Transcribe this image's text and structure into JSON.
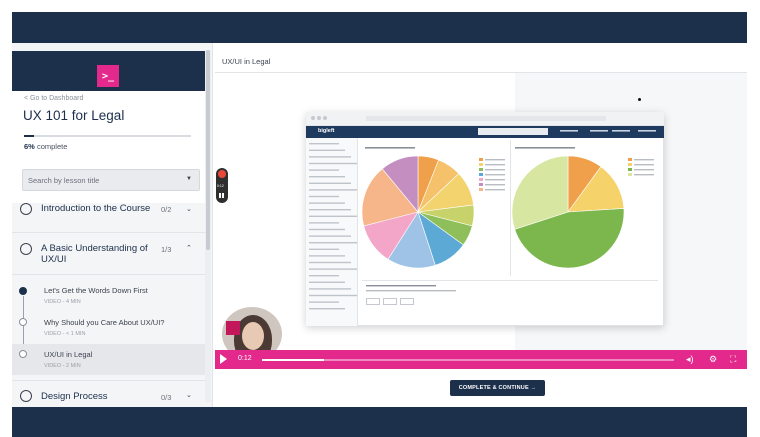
{
  "sidebar": {
    "logo_glyph": ">_",
    "back_link": "< Go to Dashboard",
    "course_title": "UX 101 for Legal",
    "progress": {
      "percent": 6,
      "value_text": "6%",
      "label": "complete"
    },
    "search": {
      "placeholder": "Search by lesson title"
    },
    "sections": [
      {
        "title": "Introduction to the Course",
        "count": "0/2",
        "expanded": false
      },
      {
        "title": "A Basic Understanding of UX/UI",
        "count": "1/3",
        "expanded": true
      },
      {
        "title": "Design Process",
        "count": "0/3",
        "expanded": false
      }
    ],
    "lessons": [
      {
        "title": "Let's Get the Words Down First",
        "meta": "VIDEO - 4 MIN",
        "completed": true
      },
      {
        "title": "Why Should you Care About UX/UI?",
        "meta": "VIDEO - < 1 MIN",
        "completed": false
      },
      {
        "title": "UX/UI in Legal",
        "meta": "VIDEO - 2 MIN",
        "completed": false,
        "active": true
      }
    ]
  },
  "main": {
    "breadcrumb": "UX/UI in Legal",
    "player": {
      "time": "0:12",
      "progress_fraction": 0.15,
      "recording_time": "0:12"
    },
    "complete_button": "COMPLETE & CONTINUE →"
  },
  "screen_in_video": {
    "brand": "bigleft"
  },
  "colors": {
    "navy": "#1c2f4b",
    "accent_pink": "#e3298b"
  }
}
